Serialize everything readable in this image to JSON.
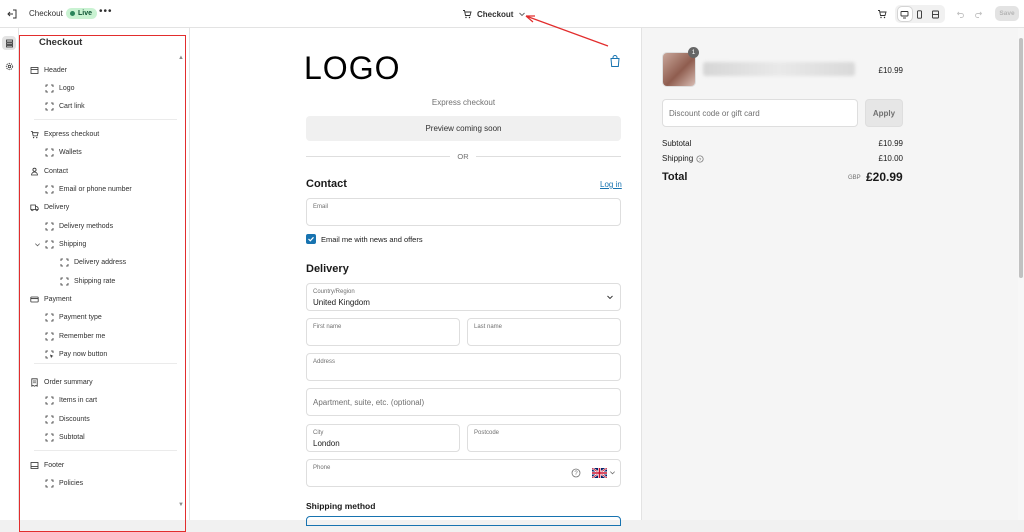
{
  "topbar": {
    "title": "Checkout",
    "status": "Live",
    "more": "•••",
    "page": "Checkout",
    "save_label": "Save"
  },
  "sidebar": {
    "title": "Checkout",
    "items": [
      {
        "label": "Header",
        "icon": "header-icon"
      },
      {
        "label": "Logo",
        "icon": "block-icon"
      },
      {
        "label": "Cart link",
        "icon": "block-icon"
      },
      {
        "label": "Express checkout",
        "icon": "cart-icon"
      },
      {
        "label": "Wallets",
        "icon": "block-icon"
      },
      {
        "label": "Contact",
        "icon": "person-icon"
      },
      {
        "label": "Email or phone number",
        "icon": "block-icon"
      },
      {
        "label": "Delivery",
        "icon": "truck-icon"
      },
      {
        "label": "Delivery methods",
        "icon": "block-icon"
      },
      {
        "label": "Shipping",
        "icon": "block-icon"
      },
      {
        "label": "Delivery address",
        "icon": "block-icon"
      },
      {
        "label": "Shipping rate",
        "icon": "block-icon"
      },
      {
        "label": "Payment",
        "icon": "card-icon"
      },
      {
        "label": "Payment type",
        "icon": "block-icon"
      },
      {
        "label": "Remember me",
        "icon": "block-icon"
      },
      {
        "label": "Pay now button",
        "icon": "button-icon"
      },
      {
        "label": "Order summary",
        "icon": "receipt-icon"
      },
      {
        "label": "Items in cart",
        "icon": "block-icon"
      },
      {
        "label": "Discounts",
        "icon": "block-icon"
      },
      {
        "label": "Subtotal",
        "icon": "block-icon"
      },
      {
        "label": "Footer",
        "icon": "footer-icon"
      },
      {
        "label": "Policies",
        "icon": "block-icon"
      }
    ]
  },
  "checkout": {
    "logo": "LOGO",
    "express_label": "Express checkout",
    "preview_text": "Preview coming soon",
    "or_text": "OR",
    "contact_heading": "Contact",
    "login_link": "Log in",
    "email_label": "Email",
    "newsletter_label": "Email me with news and offers",
    "delivery_heading": "Delivery",
    "country_label": "Country/Region",
    "country_value": "United Kingdom",
    "first_name_label": "First name",
    "last_name_label": "Last name",
    "address_label": "Address",
    "apartment_placeholder": "Apartment, suite, etc. (optional)",
    "city_label": "City",
    "city_value": "London",
    "postcode_label": "Postcode",
    "phone_label": "Phone",
    "shipping_method_heading": "Shipping method"
  },
  "summary": {
    "quantity": "1",
    "item_price": "£10.99",
    "discount_placeholder": "Discount code or gift card",
    "apply_label": "Apply",
    "subtotal_label": "Subtotal",
    "subtotal_value": "£10.99",
    "shipping_label": "Shipping",
    "shipping_value": "£10.00",
    "total_label": "Total",
    "currency": "GBP",
    "total_value": "£20.99"
  },
  "colors": {
    "annotation": "#e22d2d",
    "link": "#1773b0",
    "live_badge": "#c9f2d2"
  }
}
